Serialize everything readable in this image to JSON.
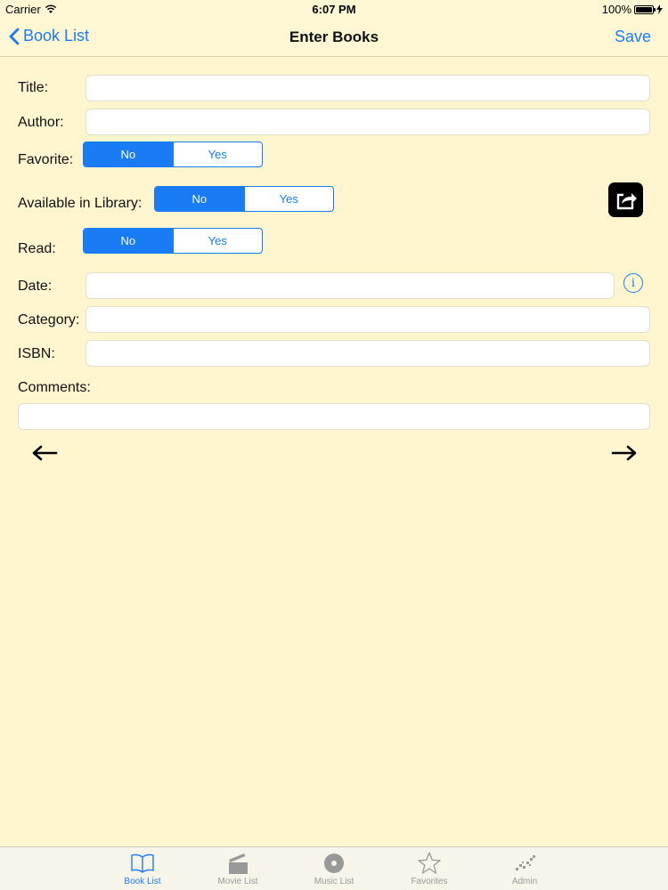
{
  "status_bar": {
    "carrier": "Carrier",
    "time": "6:07 PM",
    "battery": "100%"
  },
  "nav": {
    "back_label": "Book List",
    "title": "Enter Books",
    "save_label": "Save"
  },
  "form": {
    "title_label": "Title:",
    "title_value": "",
    "author_label": "Author:",
    "author_value": "",
    "favorite_label": "Favorite:",
    "favorite_options": [
      "No",
      "Yes"
    ],
    "favorite_selected": "No",
    "available_label": "Available in Library:",
    "available_options": [
      "No",
      "Yes"
    ],
    "available_selected": "No",
    "read_label": "Read:",
    "read_options": [
      "No",
      "Yes"
    ],
    "read_selected": "No",
    "date_label": "Date:",
    "date_value": "",
    "category_label": "Category:",
    "category_value": "",
    "isbn_label": "ISBN:",
    "isbn_value": "",
    "comments_label": "Comments:",
    "comments_value": ""
  },
  "icons": {
    "share": "share-icon",
    "info": "info-icon",
    "prev": "arrow-left-icon",
    "next": "arrow-right-icon"
  },
  "tabs": [
    {
      "label": "Book List",
      "icon": "book-icon",
      "active": true
    },
    {
      "label": "Movie List",
      "icon": "clapperboard-icon",
      "active": false
    },
    {
      "label": "Music List",
      "icon": "disc-icon",
      "active": false
    },
    {
      "label": "Favorites",
      "icon": "star-icon",
      "active": false
    },
    {
      "label": "Admin",
      "icon": "admin-icon",
      "active": false
    }
  ],
  "colors": {
    "accent": "#1a7cf5",
    "background": "#fff6cf",
    "tab_inactive": "#999999"
  }
}
